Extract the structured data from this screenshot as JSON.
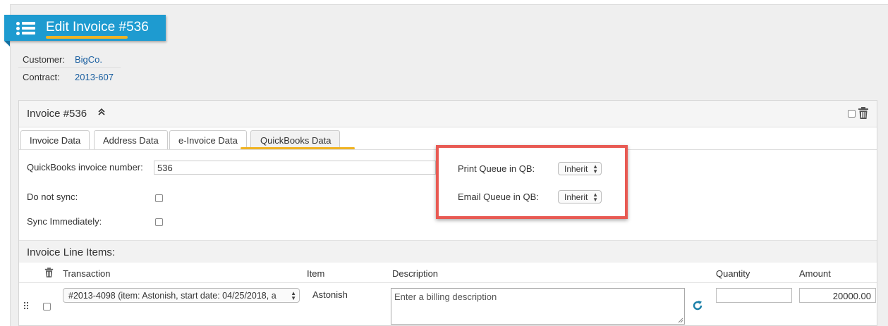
{
  "header": {
    "title": "Edit Invoice #536"
  },
  "meta": {
    "customer_label": "Customer:",
    "customer_value": "BigCo.",
    "contract_label": "Contract:",
    "contract_value": "2013-607"
  },
  "panel": {
    "title": "Invoice #536",
    "collapse_glyph": "«"
  },
  "tabs": [
    {
      "label": "Invoice Data"
    },
    {
      "label": "Address Data"
    },
    {
      "label": "e-Invoice Data"
    },
    {
      "label": "QuickBooks Data"
    }
  ],
  "active_tab": "QuickBooks Data",
  "form": {
    "qb_invoice_number_label": "QuickBooks invoice number:",
    "qb_invoice_number_value": "536",
    "do_not_sync_label": "Do not sync:",
    "do_not_sync_checked": false,
    "sync_immediately_label": "Sync Immediately:",
    "sync_immediately_checked": false,
    "print_queue_label": "Print Queue in QB:",
    "print_queue_value": "Inherit",
    "email_queue_label": "Email Queue in QB:",
    "email_queue_value": "Inherit"
  },
  "line_items": {
    "title": "Invoice Line Items:",
    "columns": {
      "transaction": "Transaction",
      "item": "Item",
      "description": "Description",
      "quantity": "Quantity",
      "amount": "Amount"
    },
    "rows": [
      {
        "transaction": "#2013-4098 (item: Astonish, start date: 04/25/2018, a",
        "item": "Astonish",
        "description_placeholder": "Enter a billing description",
        "quantity": "",
        "amount": "20000.00"
      }
    ]
  },
  "colors": {
    "banner": "#1e9bd0",
    "highlight_underline": "#f0b323",
    "callout_border": "#e85a53",
    "link": "#1a5fa0",
    "refresh_icon": "#1a7fa8"
  }
}
